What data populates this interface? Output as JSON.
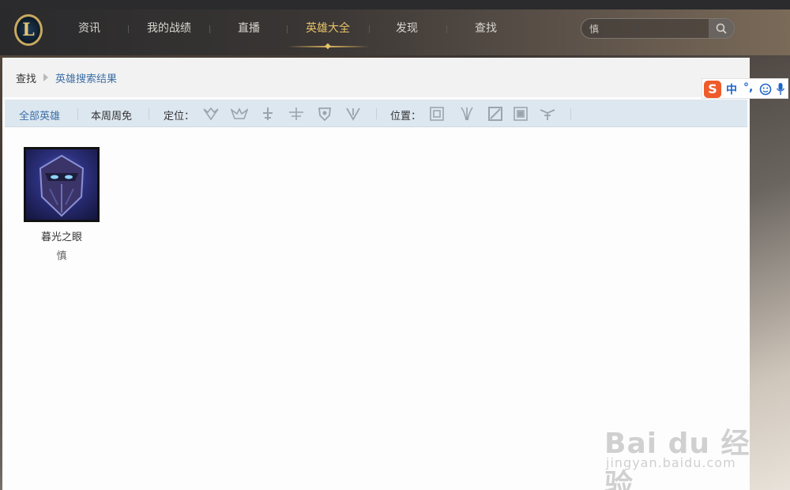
{
  "nav": {
    "logo_letter": "L",
    "items": [
      "资讯",
      "我的战绩",
      "直播",
      "英雄大全",
      "发现",
      "查找"
    ],
    "active_index": 3,
    "search_value": "慎"
  },
  "breadcrumb": {
    "root": "查找",
    "current": "英雄搜索结果"
  },
  "filter": {
    "all_heroes": "全部英雄",
    "weekly_free": "本周周免",
    "role_label": "定位：",
    "position_label": "位置：",
    "role_icons": [
      "assassin-icon",
      "mage-icon",
      "fighter-icon",
      "marksman-icon",
      "tank-icon",
      "support-icon"
    ],
    "position_icons": [
      "top-lane-icon",
      "jungle-icon",
      "mid-lane-icon",
      "bottom-lane-icon",
      "support-lane-icon"
    ]
  },
  "results": [
    {
      "name": "暮光之眼",
      "title": "慎"
    }
  ],
  "ime": {
    "logo": "S",
    "text1": "中",
    "text2": "°,"
  },
  "watermark": {
    "brand": "Bai du 经验",
    "url": "jingyan.baidu.com"
  },
  "colors": {
    "accent_gold": "#e6c36a",
    "link_blue": "#3d6fa6",
    "filter_bg": "#dde7f0"
  }
}
